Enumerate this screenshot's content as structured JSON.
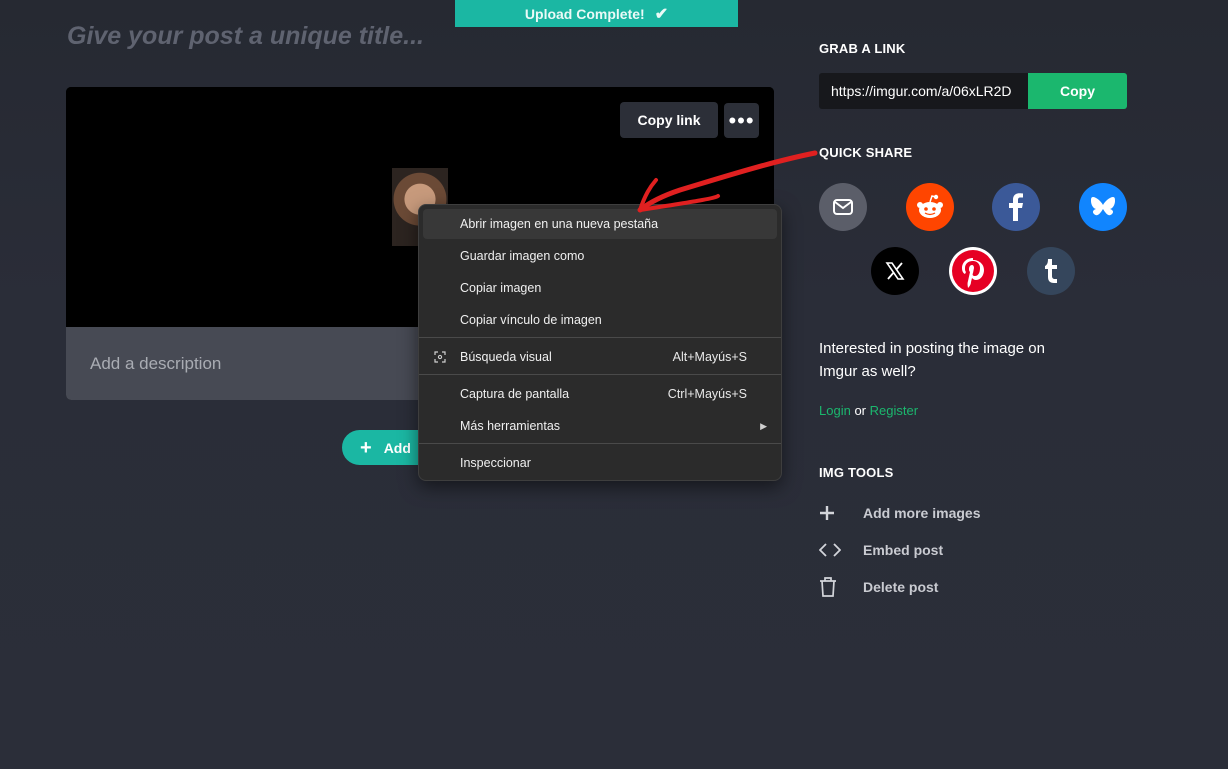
{
  "toast": {
    "text": "Upload Complete!"
  },
  "post": {
    "title_placeholder": "Give your post a unique title...",
    "copy_link": "Copy link",
    "more": "•••",
    "description_placeholder": "Add a description",
    "add_button": "Add"
  },
  "context_menu": {
    "items": [
      {
        "label": "Abrir imagen en una nueva pestaña",
        "shortcut": ""
      },
      {
        "label": "Guardar imagen como",
        "shortcut": ""
      },
      {
        "label": "Copiar imagen",
        "shortcut": ""
      },
      {
        "label": "Copiar vínculo de imagen",
        "shortcut": ""
      },
      {
        "label": "Búsqueda visual",
        "shortcut": "Alt+Mayús+S"
      },
      {
        "label": "Captura de pantalla",
        "shortcut": "Ctrl+Mayús+S"
      },
      {
        "label": "Más herramientas",
        "shortcut": ""
      },
      {
        "label": "Inspeccionar",
        "shortcut": ""
      }
    ]
  },
  "sidebar": {
    "grab_link": {
      "heading": "GRAB A LINK",
      "url": "https://imgur.com/a/06xLR2D",
      "copy": "Copy"
    },
    "quick_share": {
      "heading": "QUICK SHARE",
      "services": [
        "email-icon",
        "reddit-icon",
        "facebook-icon",
        "bluesky-icon",
        "x-icon",
        "pinterest-icon",
        "tumblr-icon"
      ]
    },
    "interest": "Interested in posting the image on Imgur as well?",
    "login": "Login",
    "or": "or",
    "register": "Register",
    "img_tools": {
      "heading": "IMG TOOLS",
      "items": [
        {
          "label": "Add more images",
          "icon": "plus-icon"
        },
        {
          "label": "Embed post",
          "icon": "code-icon"
        },
        {
          "label": "Delete post",
          "icon": "trash-icon"
        }
      ]
    }
  },
  "colors": {
    "accent_teal": "#1bb7a3",
    "accent_green": "#1bb76e",
    "annotation_red": "#e02020"
  }
}
